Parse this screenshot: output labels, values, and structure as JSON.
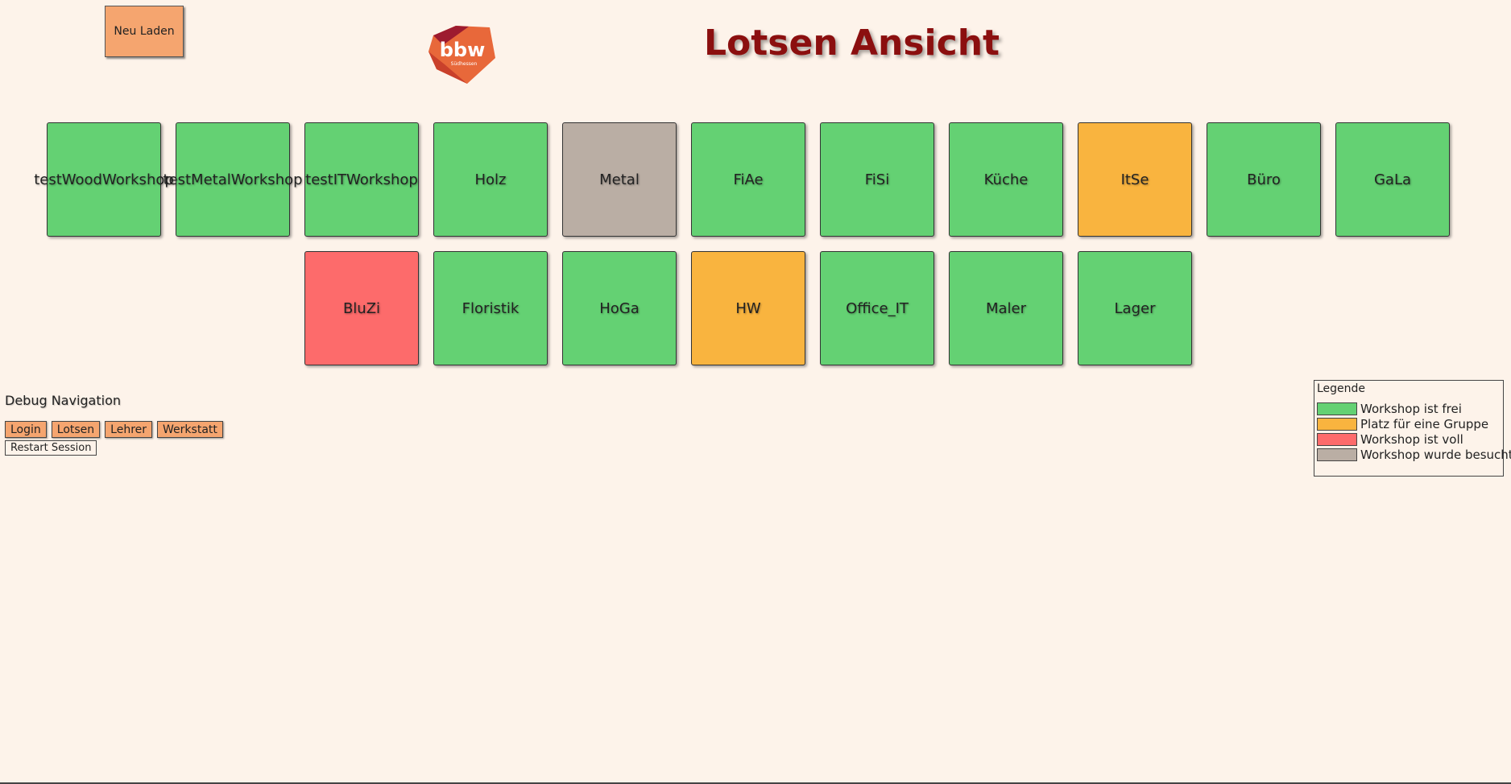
{
  "header": {
    "reload_label": "Neu Laden",
    "title": "Lotsen Ansicht",
    "logo_text": "bbw",
    "logo_subtext": "Südhessen"
  },
  "colors": {
    "free": "#64d173",
    "group": "#f9b43f",
    "full": "#fd6b6b",
    "visited": "#baaea4",
    "title": "#8b0f0f",
    "button": "#f5a56f",
    "background": "#fdf3ea"
  },
  "workshops": [
    {
      "name": "testWoodWorkshop",
      "status": "free"
    },
    {
      "name": "testMetalWorkshop",
      "status": "free"
    },
    {
      "name": "testITWorkshop",
      "status": "free"
    },
    {
      "name": "Holz",
      "status": "free"
    },
    {
      "name": "Metal",
      "status": "visited"
    },
    {
      "name": "FiAe",
      "status": "free"
    },
    {
      "name": "FiSi",
      "status": "free"
    },
    {
      "name": "Küche",
      "status": "free"
    },
    {
      "name": "ItSe",
      "status": "group"
    },
    {
      "name": "Büro",
      "status": "free"
    },
    {
      "name": "GaLa",
      "status": "free"
    },
    {
      "name": "BluZi",
      "status": "full"
    },
    {
      "name": "Floristik",
      "status": "free"
    },
    {
      "name": "HoGa",
      "status": "free"
    },
    {
      "name": "HW",
      "status": "group"
    },
    {
      "name": "Office_IT",
      "status": "free"
    },
    {
      "name": "Maler",
      "status": "free"
    },
    {
      "name": "Lager",
      "status": "free"
    }
  ],
  "debug": {
    "title": "Debug Navigation",
    "buttons": [
      "Login",
      "Lotsen",
      "Lehrer",
      "Werkstatt"
    ],
    "restart_label": "Restart Session"
  },
  "legend": {
    "title": "Legende",
    "items": [
      {
        "label": "Workshop ist frei",
        "status": "free"
      },
      {
        "label": "Platz für eine Gruppe",
        "status": "group"
      },
      {
        "label": "Workshop ist voll",
        "status": "full"
      },
      {
        "label": "Workshop wurde besucht",
        "status": "visited"
      }
    ]
  }
}
